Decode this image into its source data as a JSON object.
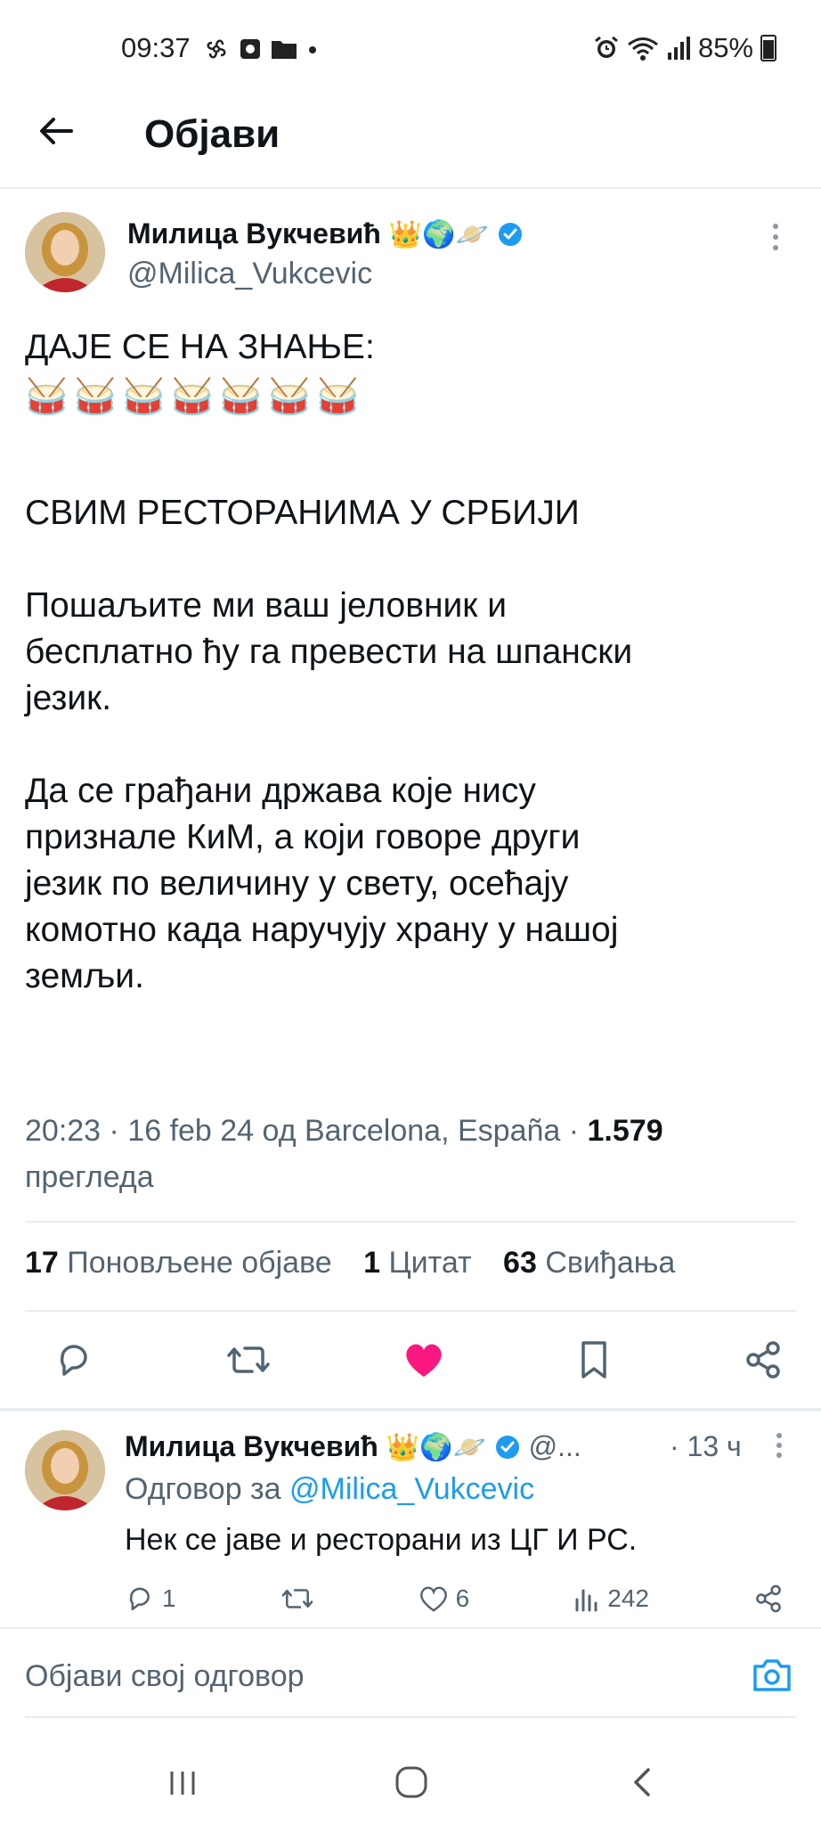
{
  "status_bar": {
    "time": "09:37",
    "battery": "85%"
  },
  "header": {
    "title": "Објави"
  },
  "tweet": {
    "author_name": "Милица Вукчевић",
    "author_emojis": "👑🌍🪐",
    "handle": "@Milica_Vukcevic",
    "lines": {
      "l1": "ДАЈЕ СЕ НА ЗНАЊЕ:",
      "l2": "СВИМ РЕСТОРАНИМА У СРБИЈИ",
      "l3a": "Пошаљите ми ваш јеловник и",
      "l3b": "бесплатно ћу га превести на шпански",
      "l3c": "језик.",
      "l4a": "Да се грађани држава које нису",
      "l4b": "признале КиМ, а који говоре други",
      "l4c": "језик по величину у свету, осећају",
      "l4d": "комотно када наручују храну у нашој",
      "l4e": "земљи."
    },
    "drum_emoji": "🥁",
    "meta_prefix": "20:23 · 16 feb 24 од Barcelona, España · ",
    "views_count": "1.579",
    "views_label": "прегледа",
    "stats": {
      "retweets_count": "17",
      "retweets_label": "Поновљене објаве",
      "quotes_count": "1",
      "quotes_label": "Цитат",
      "likes_count": "63",
      "likes_label": "Свиђања"
    }
  },
  "reply": {
    "author_name": "Милица Вукчевић",
    "author_emojis": "👑🌍🪐",
    "handle_short": "@...",
    "time": "· 13 ч",
    "reply_to_prefix": "Одговор за ",
    "reply_to_handle": "@Milica_Vukcevic",
    "text": "Нек се јаве и ресторани из ЦГ И РС.",
    "replies": "1",
    "likes": "6",
    "views": "242"
  },
  "compose": {
    "placeholder": "Објави свој одговор"
  },
  "colors": {
    "accent": "#1d9bf0",
    "like": "#f91880",
    "secondary": "#536471"
  }
}
